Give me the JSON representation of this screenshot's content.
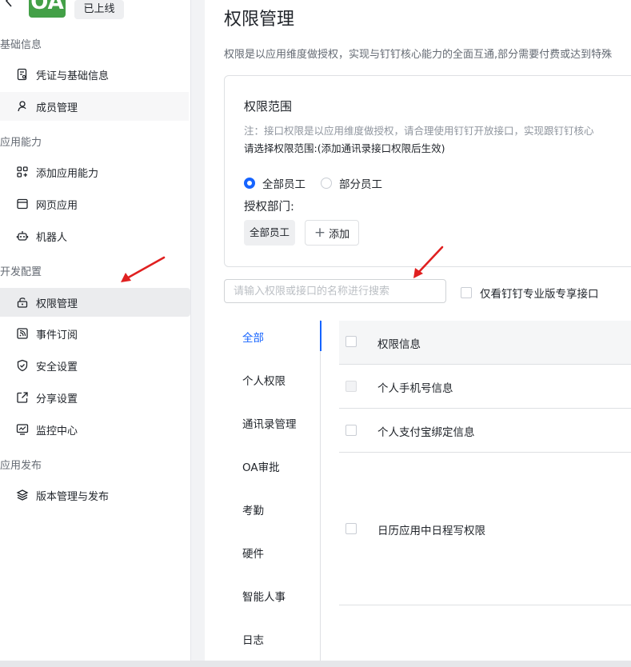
{
  "app": {
    "logo_text": "OA",
    "status_badge": "已上线"
  },
  "sidebar": {
    "groups": [
      {
        "title": "基础信息",
        "items": [
          {
            "label": "凭证与基础信息",
            "icon": "credential-icon"
          },
          {
            "label": "成员管理",
            "icon": "user-icon"
          }
        ]
      },
      {
        "title": "应用能力",
        "items": [
          {
            "label": "添加应用能力",
            "icon": "apps-add-icon"
          },
          {
            "label": "网页应用",
            "icon": "browser-window-icon"
          },
          {
            "label": "机器人",
            "icon": "robot-icon"
          }
        ]
      },
      {
        "title": "开发配置",
        "items": [
          {
            "label": "权限管理",
            "icon": "unlock-icon",
            "active": true
          },
          {
            "label": "事件订阅",
            "icon": "rss-icon"
          },
          {
            "label": "安全设置",
            "icon": "shield-icon"
          },
          {
            "label": "分享设置",
            "icon": "share-icon"
          },
          {
            "label": "监控中心",
            "icon": "monitor-icon"
          }
        ]
      },
      {
        "title": "应用发布",
        "items": [
          {
            "label": "版本管理与发布",
            "icon": "layers-icon"
          }
        ]
      }
    ]
  },
  "main": {
    "title": "权限管理",
    "description": "权限是以应用维度做授权，实现与钉钉核心能力的全面互通,部分需要付费或达到特殊",
    "scope": {
      "title": "权限范围",
      "note": "注：接口权限是以应用维度做授权，请合理使用钉钉开放接口，实现跟钉钉核心",
      "hint": "请选择权限范围:(添加通讯录接口权限后生效)",
      "options": [
        {
          "label": "全部员工",
          "selected": true
        },
        {
          "label": "部分员工",
          "selected": false
        }
      ],
      "dept_label": "授权部门:",
      "dept_tag": "全部员工",
      "add_label": "添加"
    },
    "search": {
      "placeholder": "请输入权限或接口的名称进行搜索",
      "value": ""
    },
    "pro_only_label": "仅看钉钉专业版专享接口",
    "categories": [
      "全部",
      "个人权限",
      "通讯录管理",
      "OA审批",
      "考勤",
      "硬件",
      "智能人事",
      "日志"
    ],
    "active_category": "全部",
    "table": {
      "header": "权限信息",
      "rows": [
        "个人手机号信息",
        "个人支付宝绑定信息",
        "日历应用中日程写权限"
      ]
    }
  },
  "colors": {
    "accent": "#1664ff",
    "logo_bg": "#43a047",
    "annotation_arrow": "#e02020"
  }
}
